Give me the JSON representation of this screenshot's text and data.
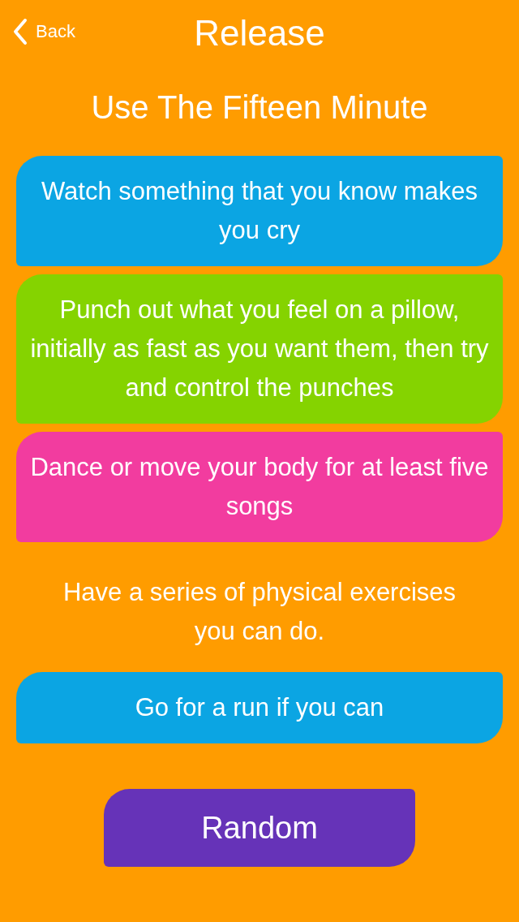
{
  "nav": {
    "back": "Back",
    "title": "Release"
  },
  "heading": "Use The Fifteen Minute",
  "items": [
    {
      "kind": "card",
      "color": "#0ba5e3",
      "text": "Watch something that you know makes you cry"
    },
    {
      "kind": "card",
      "color": "#85d300",
      "text": "Punch out what you feel on a pillow, initially as fast as you want them, then try and control the punches"
    },
    {
      "kind": "card",
      "color": "#f23c9f",
      "text": "Dance or move your body for at least five songs"
    },
    {
      "kind": "text",
      "text": "Have a series of physical exercises you can do."
    },
    {
      "kind": "card",
      "color": "#0ba5e3",
      "text": "Go for a run if you can"
    }
  ],
  "button": "Random"
}
